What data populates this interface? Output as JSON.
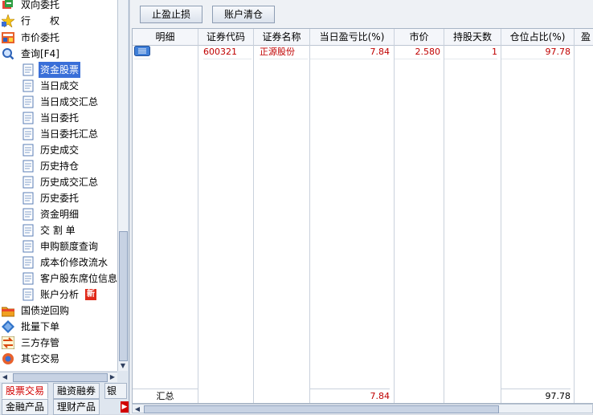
{
  "tree": {
    "top_items": [
      {
        "label": "双向委托",
        "icon": "two-way-order-icon"
      },
      {
        "label": "行　　权",
        "icon": "exercise-star-icon"
      },
      {
        "label": "市价委托",
        "icon": "market-order-icon"
      },
      {
        "label": "查询[F4]",
        "icon": "query-magnifier-icon"
      }
    ],
    "query_children": [
      {
        "label": "资金股票",
        "selected": true
      },
      {
        "label": "当日成交"
      },
      {
        "label": "当日成交汇总"
      },
      {
        "label": "当日委托"
      },
      {
        "label": "当日委托汇总"
      },
      {
        "label": "历史成交"
      },
      {
        "label": "历史持仓"
      },
      {
        "label": "历史成交汇总"
      },
      {
        "label": "历史委托"
      },
      {
        "label": "资金明细"
      },
      {
        "label": "交 割 单"
      },
      {
        "label": "申购额度查询"
      },
      {
        "label": "成本价修改流水"
      },
      {
        "label": "客户股东席位信息"
      },
      {
        "label": "账户分析",
        "badge": "新"
      }
    ],
    "bottom_items": [
      {
        "label": "国债逆回购"
      },
      {
        "label": "批量下单"
      },
      {
        "label": "三方存管"
      },
      {
        "label": "其它交易"
      }
    ]
  },
  "bottom_tabs": {
    "row1": [
      "股票交易",
      "融资融券",
      "银行"
    ],
    "row2": [
      "金融产品",
      "理财产品"
    ]
  },
  "toolbar": {
    "stop_profit_loss": "止盈止损",
    "account_clear": "账户清仓"
  },
  "grid": {
    "headers": [
      "明细",
      "证券代码",
      "证券名称",
      "当日盈亏比(%)",
      "市价",
      "持股天数",
      "仓位占比(%)",
      "盈"
    ],
    "rows": [
      {
        "code": "600321",
        "name": "正源股份",
        "day_pl_pct": "7.84",
        "price": "2.580",
        "days": "1",
        "position_pct": "97.78"
      }
    ],
    "summary": {
      "label": "汇总",
      "day_pl_pct": "7.84",
      "position_pct": "97.78"
    }
  },
  "colors": {
    "accent_red": "#c00000",
    "selection_blue": "#3a6fd8"
  }
}
